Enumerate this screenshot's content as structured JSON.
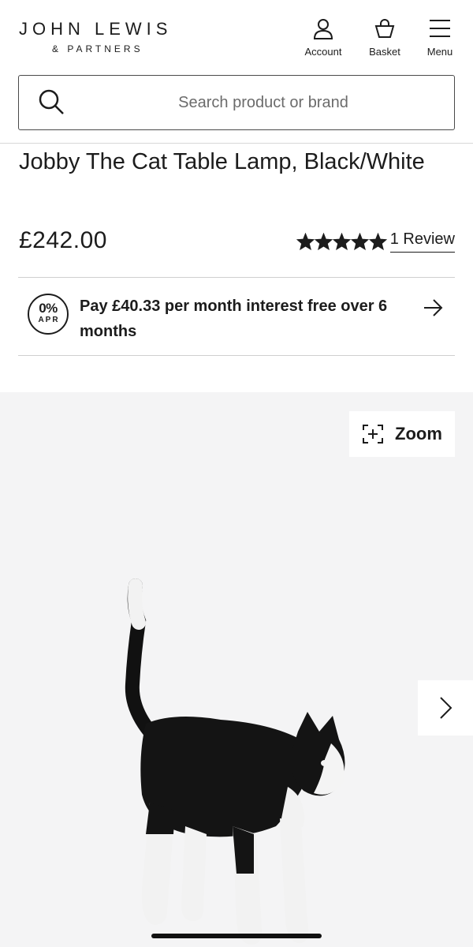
{
  "header": {
    "logo_main": "JOHN LEWIS",
    "logo_sub": "& PARTNERS",
    "account_label": "Account",
    "basket_label": "Basket",
    "menu_label": "Menu"
  },
  "search": {
    "placeholder": "Search product or brand",
    "value": ""
  },
  "product": {
    "title": "Jobby The Cat Table Lamp, Black/White",
    "price": "£242.00",
    "rating": 5,
    "rating_max": 5,
    "review_link": "1 Review"
  },
  "finance": {
    "badge_percent": "0%",
    "badge_apr": "APR",
    "text": "Pay £40.33 per month interest free over 6 months"
  },
  "gallery": {
    "zoom_label": "Zoom",
    "background": "#f4f4f5"
  },
  "colors": {
    "text": "#1c1c1c",
    "border": "#4a4a4a"
  }
}
